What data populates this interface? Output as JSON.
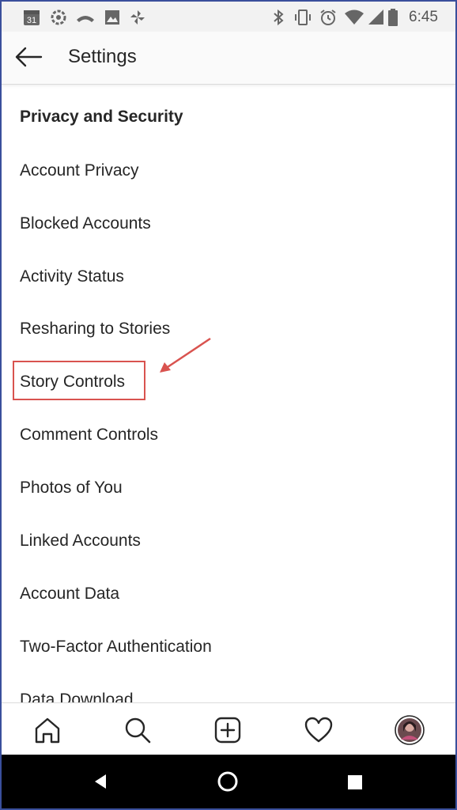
{
  "status_bar": {
    "time": "6:45",
    "calendar_day": "31",
    "icons": [
      "calendar-icon",
      "settings-icon",
      "missed-call-icon",
      "image-icon",
      "pinwheel-icon",
      "bluetooth-icon",
      "vibrate-icon",
      "alarm-icon",
      "wifi-icon",
      "signal-icon",
      "battery-icon"
    ]
  },
  "header": {
    "title": "Settings"
  },
  "section": {
    "title": "Privacy and Security"
  },
  "items": [
    {
      "label": "Account Privacy"
    },
    {
      "label": "Blocked Accounts"
    },
    {
      "label": "Activity Status"
    },
    {
      "label": "Resharing to Stories"
    },
    {
      "label": "Story Controls"
    },
    {
      "label": "Comment Controls"
    },
    {
      "label": "Photos of You"
    },
    {
      "label": "Linked Accounts"
    },
    {
      "label": "Account Data"
    },
    {
      "label": "Two-Factor Authentication"
    },
    {
      "label": "Data Download"
    }
  ],
  "bottom_nav": [
    "home-icon",
    "search-icon",
    "new-post-icon",
    "heart-icon",
    "profile-avatar"
  ],
  "system_nav": [
    "back-icon",
    "home-circle-icon",
    "recents-icon"
  ],
  "colors": {
    "annotation": "#d9534f",
    "frame": "#3a4f9c",
    "text": "#262626"
  }
}
